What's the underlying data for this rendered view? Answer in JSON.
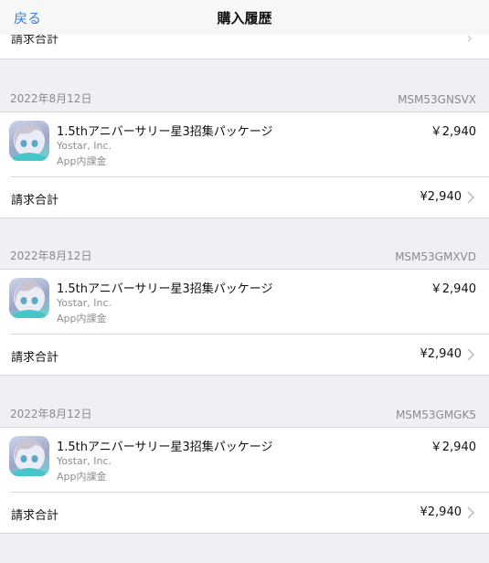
{
  "navbar": {
    "back_label": "戻る",
    "title": "購入履歴"
  },
  "partial_top": {
    "label_cut": "請求合計",
    "chevron": "chevron-right-icon"
  },
  "purchases": [
    {
      "date": "2022年8月12日",
      "order_id": "MSM53GNSVX",
      "item": {
        "title": "1.5thアニバーサリー星3招集パッケージ",
        "developer": "Yostar, Inc.",
        "type": "App内課金",
        "price": "￥2,940"
      },
      "total_label": "請求合計",
      "total_value": "¥2,940"
    },
    {
      "date": "2022年8月12日",
      "order_id": "MSM53GMXVD",
      "item": {
        "title": "1.5thアニバーサリー星3招集パッケージ",
        "developer": "Yostar, Inc.",
        "type": "App内課金",
        "price": "￥2,940"
      },
      "total_label": "請求合計",
      "total_value": "¥2,940"
    },
    {
      "date": "2022年8月12日",
      "order_id": "MSM53GMGK5",
      "item": {
        "title": "1.5thアニバーサリー星3招集パッケージ",
        "developer": "Yostar, Inc.",
        "type": "App内課金",
        "price": "￥2,940"
      },
      "total_label": "請求合計",
      "total_value": "¥2,940"
    }
  ],
  "colors": {
    "accent": "#3a7fe5",
    "background": "#efeff4",
    "secondary_text": "#8e8e93"
  }
}
